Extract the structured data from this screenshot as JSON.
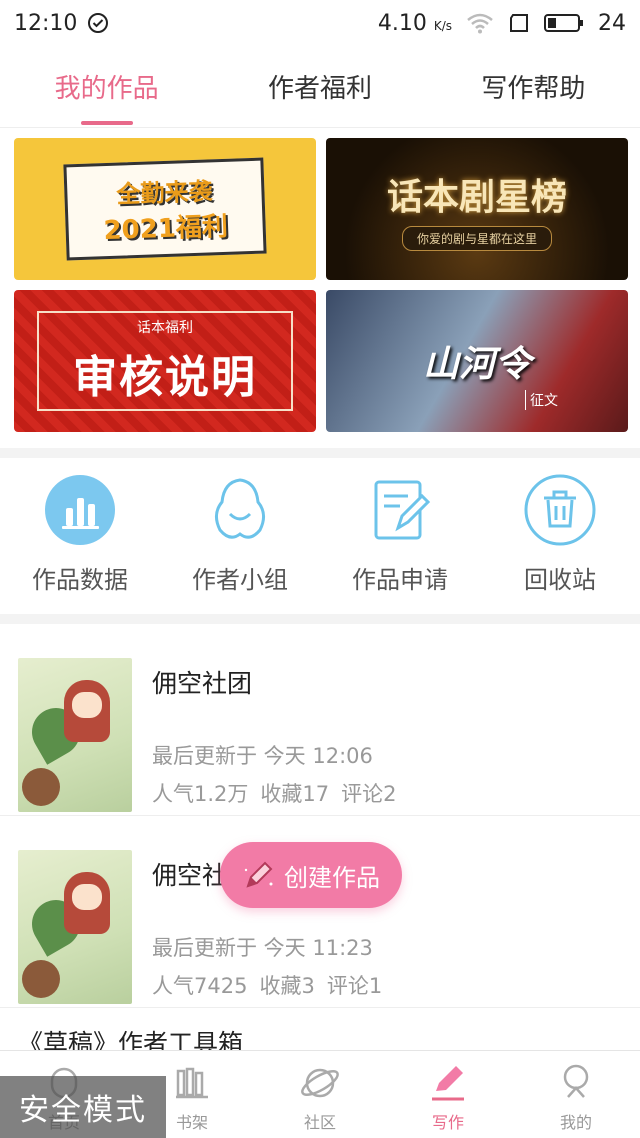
{
  "status_bar": {
    "time": "12:10",
    "speed": "4.10",
    "speed_unit": "K/s",
    "battery": "24"
  },
  "tabs": [
    {
      "label": "我的作品",
      "active": true
    },
    {
      "label": "作者福利",
      "active": false
    },
    {
      "label": "写作帮助",
      "active": false
    }
  ],
  "banners": {
    "b1": {
      "line1": "全勤来袭",
      "line2": "2021福利"
    },
    "b2": {
      "line1": "话本剧星榜",
      "line2": "你爱的剧与星都在这里"
    },
    "b3": {
      "line1": "话本福利",
      "line2": "审核说明"
    },
    "b4": {
      "line1": "山河令",
      "line2": "征文"
    }
  },
  "actions": [
    {
      "label": "作品数据",
      "icon": "bar-chart-icon"
    },
    {
      "label": "作者小组",
      "icon": "group-icon"
    },
    {
      "label": "作品申请",
      "icon": "edit-form-icon"
    },
    {
      "label": "回收站",
      "icon": "trash-icon"
    }
  ],
  "works": [
    {
      "title": "佣空社团",
      "updated": "最后更新于 今天 12:06",
      "popularity": "人气1.2万",
      "favorites": "收藏17",
      "comments": "评论2"
    },
    {
      "title": "佣空社",
      "updated": "最后更新于 今天 11:23",
      "popularity": "人气7425",
      "favorites": "收藏3",
      "comments": "评论1"
    }
  ],
  "partial_work_title": "《草稿》作者工具箱",
  "fab": {
    "label": "创建作品"
  },
  "bottom_nav": [
    {
      "label": "首页",
      "active": false
    },
    {
      "label": "书架",
      "active": false
    },
    {
      "label": "社区",
      "active": false
    },
    {
      "label": "写作",
      "active": true
    },
    {
      "label": "我的",
      "active": false
    }
  ],
  "overlay": {
    "safe_mode": "安全模式"
  },
  "colors": {
    "accent": "#e86a8a",
    "fab": "#f27ba6",
    "icon_blue": "#5bbbe8"
  }
}
